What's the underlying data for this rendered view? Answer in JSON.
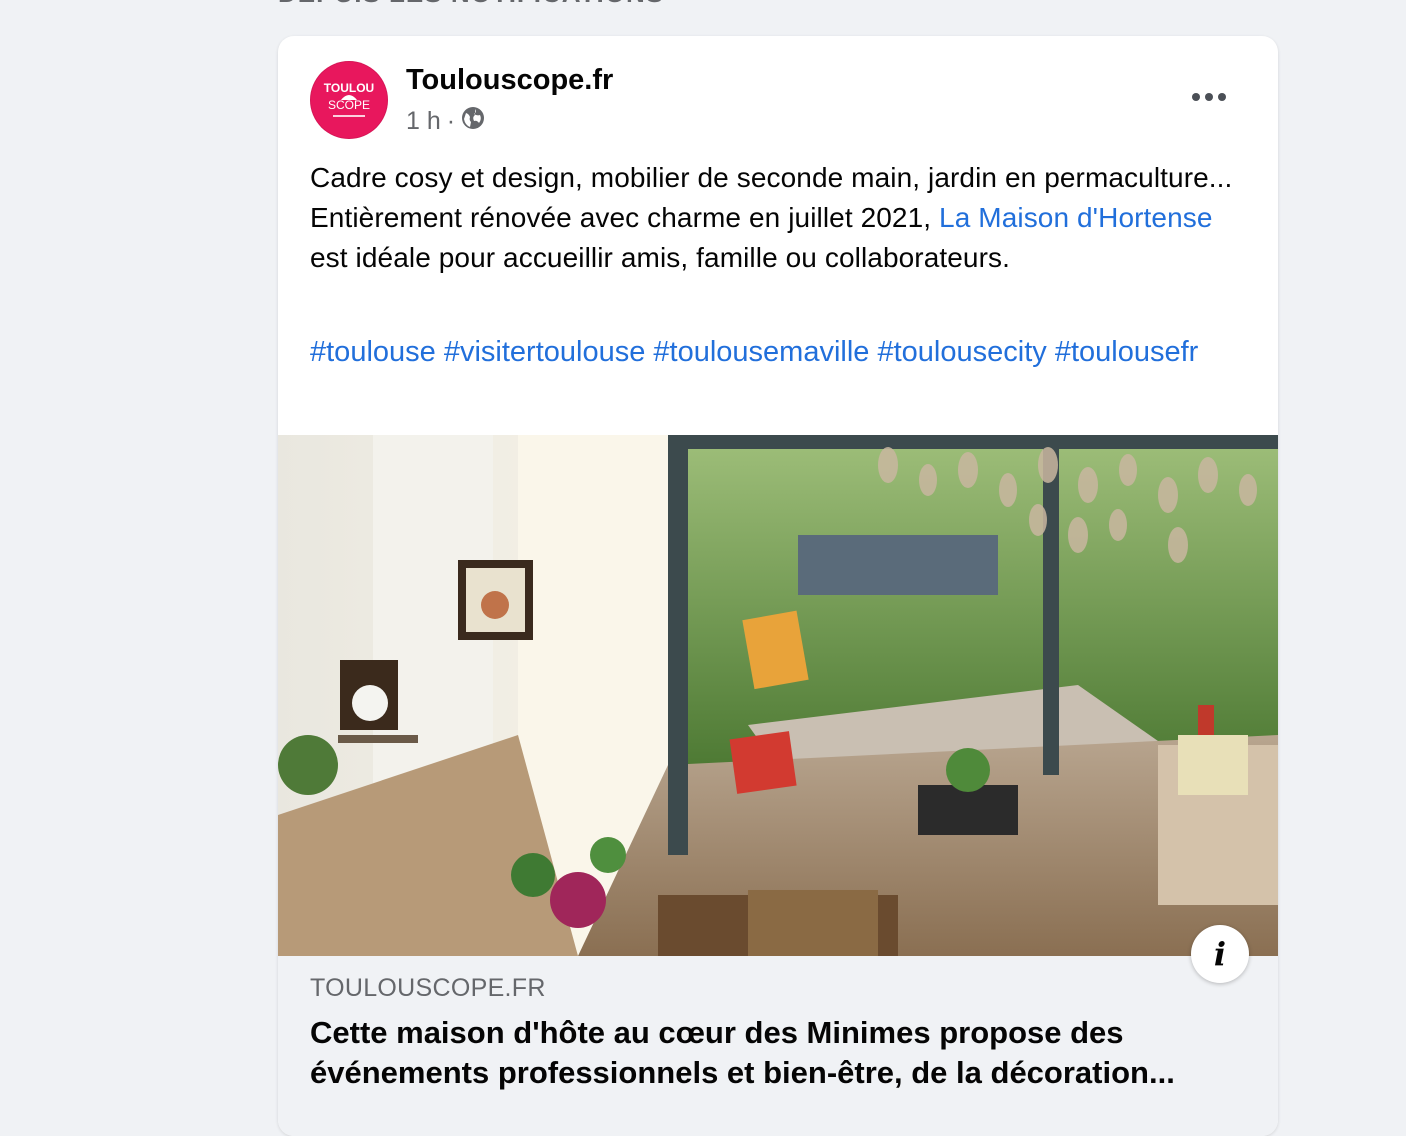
{
  "section": {
    "heading": "DEPUIS LES NOTIFICATIONS"
  },
  "post": {
    "author": "Toulouscope.fr",
    "avatar_text": "TOULOU SCOPE",
    "time": "1 h",
    "separator": "·",
    "visibility_icon": "globe-icon",
    "more_icon": "more-horizontal-icon",
    "text_before_link": "Cadre cosy et design, mobilier de seconde main, jardin en permaculture... Entièrement rénovée avec charme en juillet 2021, ",
    "link_text": "La Maison d'Hortense",
    "text_after_link": " est idéale pour accueillir amis, famille ou collaborateurs.",
    "hashtags": [
      "#toulouse",
      "#visitertoulouse",
      "#toulousemaville",
      "#toulousecity",
      "#toulousefr"
    ]
  },
  "link_preview": {
    "domain": "TOULOUSCOPE.FR",
    "title": "Cette maison d'hôte au cœur des Minimes propose des événements professionnels et bien-être, de la décoration...",
    "info_icon": "info-icon"
  },
  "colors": {
    "link": "#216fdb",
    "brand": "#e8175d",
    "background": "#f0f2f5"
  }
}
